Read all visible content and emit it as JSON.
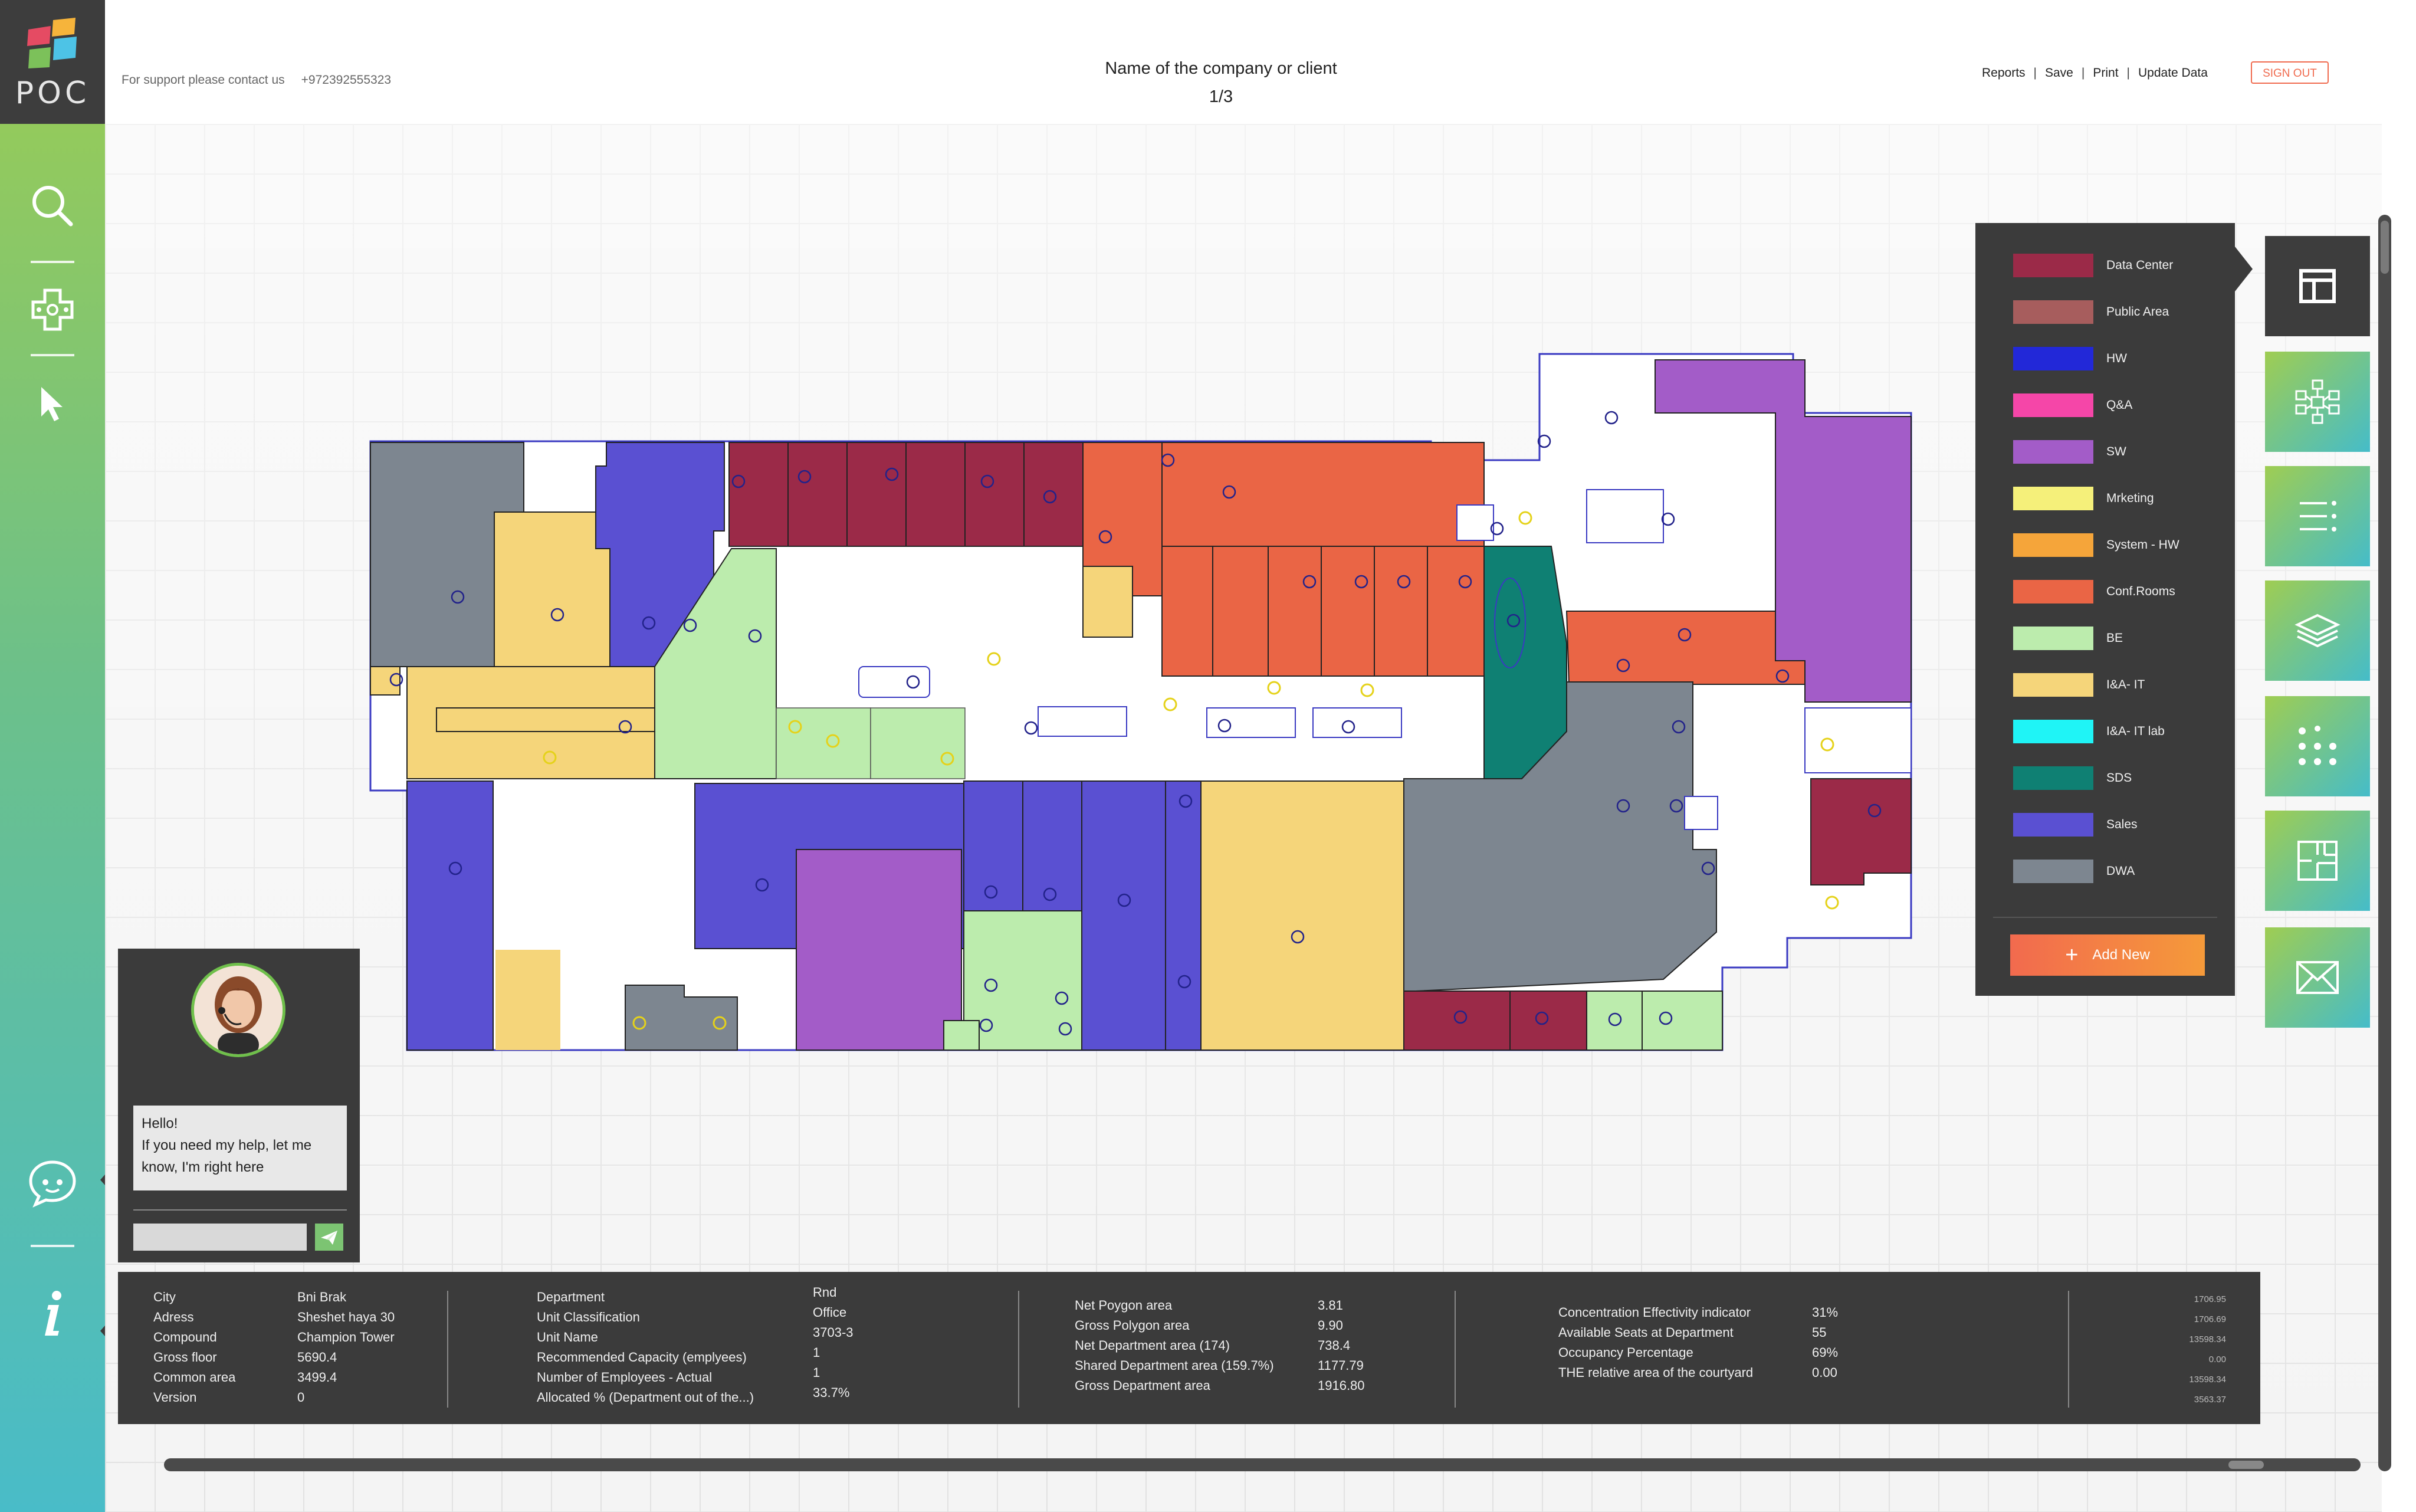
{
  "logo": {
    "text": "POC",
    "colors": [
      "#e54b63",
      "#f6b43b",
      "#4dc3e6",
      "#7cc15a"
    ]
  },
  "header": {
    "support_text": "For support please contact us",
    "support_phone": "+972392555323",
    "company": "Name of the company or client",
    "page": "1/3",
    "menu": [
      "Reports",
      "Save",
      "Print",
      "Update Data"
    ],
    "menu_sep": "|",
    "signout": "SIGN OUT"
  },
  "rail": {
    "icons": [
      "search-icon",
      "gamepad-icon",
      "pointer-icon",
      "chat-icon",
      "info-icon"
    ]
  },
  "legend": {
    "items": [
      {
        "label": "Data Center",
        "color": "#9b2a48"
      },
      {
        "label": "Public Area",
        "color": "#a75d5d"
      },
      {
        "label": "HW",
        "color": "#2228d8"
      },
      {
        "label": "Q&A",
        "color": "#f546a8"
      },
      {
        "label": "SW",
        "color": "#a35cc8"
      },
      {
        "label": "Mrketing",
        "color": "#f5f07a"
      },
      {
        "label": "System - HW",
        "color": "#f5a53a"
      },
      {
        "label": "Conf.Rooms",
        "color": "#ea6545"
      },
      {
        "label": "BE",
        "color": "#bcecad"
      },
      {
        "label": "I&A- IT",
        "color": "#f5d57a"
      },
      {
        "label": "I&A- IT lab",
        "color": "#1ff4f6"
      },
      {
        "label": "SDS",
        "color": "#0f8073"
      },
      {
        "label": "Sales",
        "color": "#5a50d2"
      },
      {
        "label": "DWA",
        "color": "#7d8690"
      }
    ],
    "add_new": "Add New"
  },
  "tools": [
    "layout-icon",
    "network-icon",
    "list-icon",
    "layers-icon",
    "grid-dots-icon",
    "floorplan-icon",
    "mail-icon"
  ],
  "chat": {
    "greeting": "Hello!",
    "message": "If you need my help, let me know, I'm right here",
    "input_placeholder": ""
  },
  "info": {
    "col1": {
      "labels": [
        "City",
        "Adress",
        "Compound",
        "Gross floor",
        "Common area",
        "Version"
      ],
      "values": [
        "Bni Brak",
        "Sheshet haya 30",
        "Champion Tower",
        "5690.4",
        "3499.4",
        "0"
      ]
    },
    "col2": {
      "labels": [
        "Department",
        "Unit Classification",
        "Unit Name",
        "Recommended Capacity (emplyees)",
        "Number of Employees - Actual",
        "Allocated % (Department out of the...)"
      ],
      "values": [
        "Rnd",
        "Office",
        "3703-3",
        "1",
        "1",
        "33.7%"
      ]
    },
    "col3": {
      "labels": [
        "Net Poygon area",
        "Gross Polygon area",
        "Net Department area (174)",
        "Shared Department area (159.7%)",
        "Gross Department area"
      ],
      "values": [
        "3.81",
        "9.90",
        "738.4",
        "1177.79",
        "1916.80"
      ]
    },
    "col4": {
      "labels": [
        "Concentration Effectivity indicator",
        "Available Seats at Department",
        "Occupancy Percentage",
        "THE relative area of the courtyard"
      ],
      "values": [
        "31%",
        "55",
        "69%",
        "0.00"
      ]
    },
    "col5": {
      "values": [
        "1706.95",
        "1706.69",
        "13598.34",
        "0.00",
        "13598.34",
        "3563.37"
      ]
    }
  }
}
